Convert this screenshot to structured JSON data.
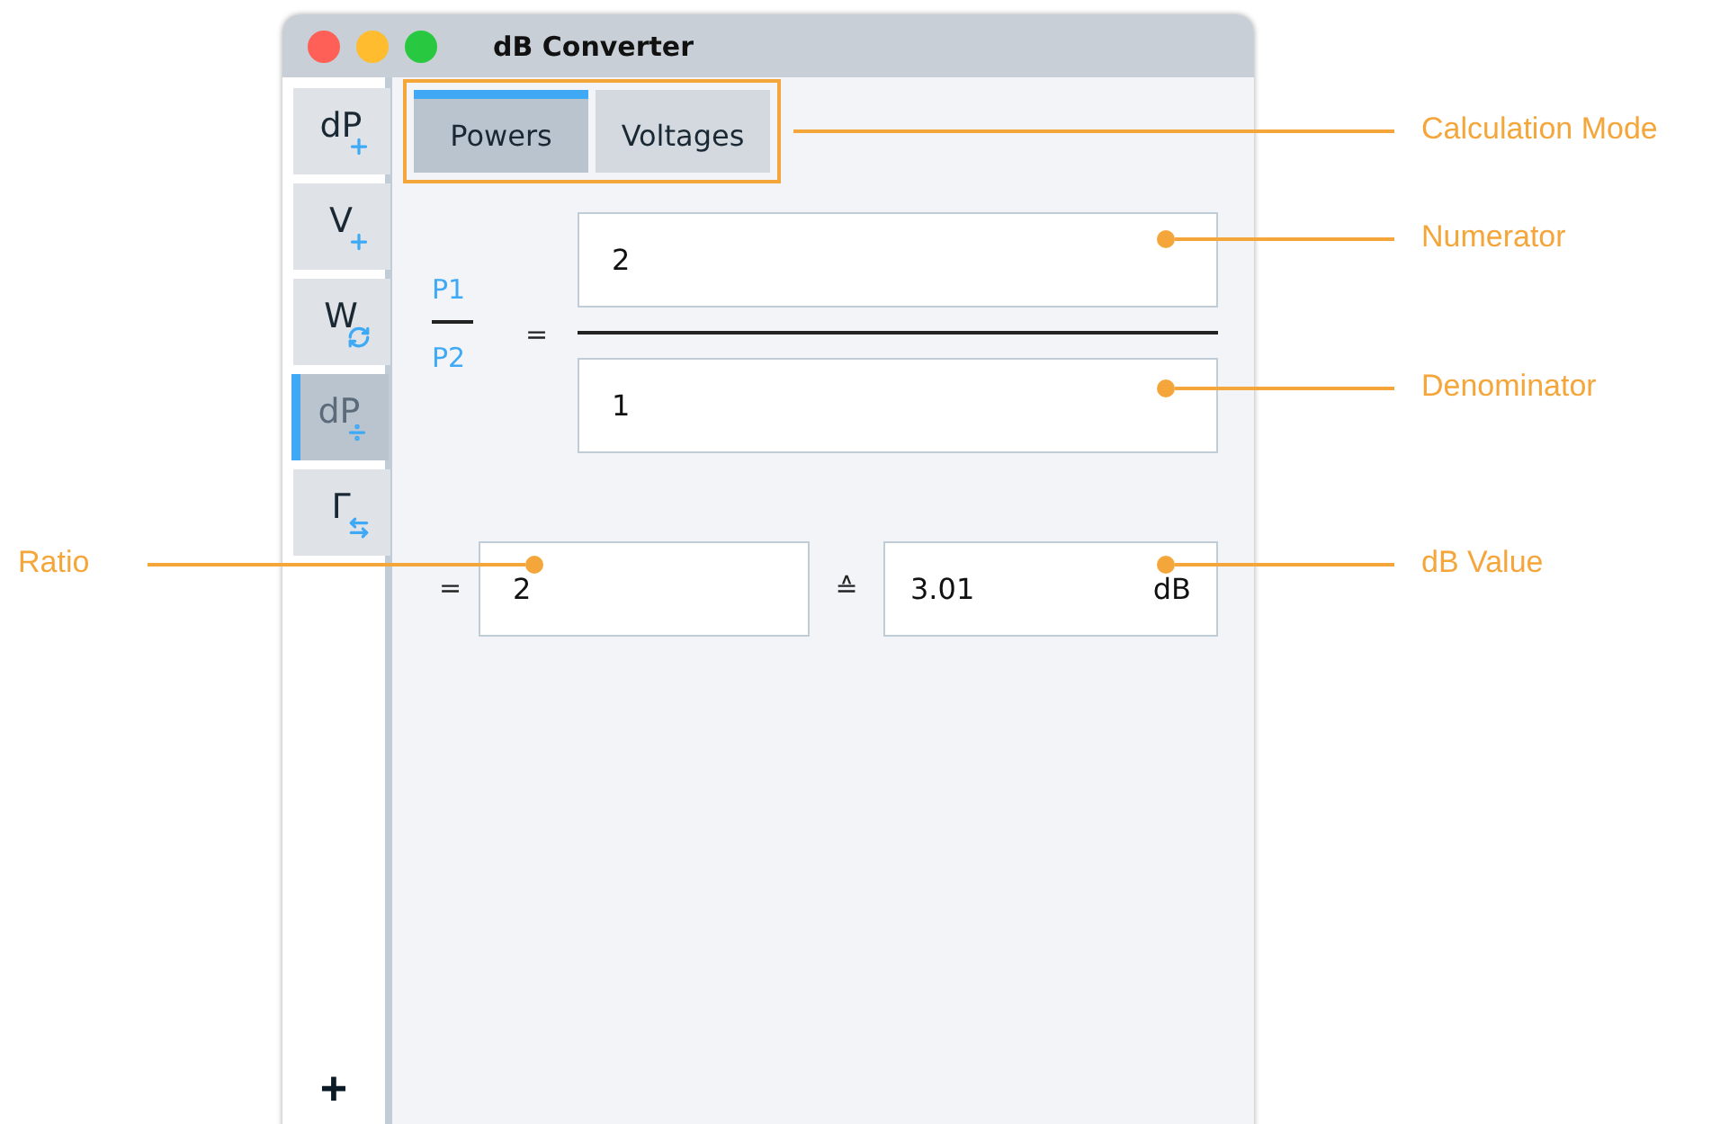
{
  "window": {
    "title": "dB Converter"
  },
  "sidebar": {
    "items": [
      {
        "label": "dP",
        "kind": "plus",
        "selected": false
      },
      {
        "label": "V",
        "kind": "plus",
        "selected": false
      },
      {
        "label": "W",
        "kind": "refresh",
        "selected": false
      },
      {
        "label": "dP",
        "kind": "divide",
        "selected": true
      },
      {
        "label": "Γ",
        "kind": "swap",
        "selected": false
      }
    ],
    "add_button": "+"
  },
  "tabs": [
    {
      "label": "Powers",
      "selected": true
    },
    {
      "label": "Voltages",
      "selected": false
    }
  ],
  "fraction": {
    "top_label": "P1",
    "bottom_label": "P2",
    "equals": "=",
    "numerator": "2",
    "denominator": "1"
  },
  "result": {
    "equals": "=",
    "ratio": "2",
    "corresponds": "≙",
    "db_value": "3.01",
    "unit": "dB"
  },
  "annotations": [
    {
      "label": "Calculation Mode"
    },
    {
      "label": "Numerator"
    },
    {
      "label": "Denominator"
    },
    {
      "label": "Ratio"
    },
    {
      "label": "dB Value"
    }
  ]
}
